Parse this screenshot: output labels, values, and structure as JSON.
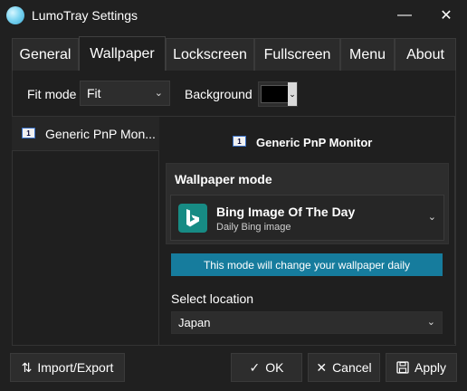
{
  "window": {
    "title": "LumoTray Settings",
    "minimize_icon": "minimize-icon",
    "close_icon": "close-icon",
    "minimize_glyph": "—",
    "close_glyph": "✕"
  },
  "tabs": [
    {
      "label": "General"
    },
    {
      "label": "Wallpaper",
      "active": true
    },
    {
      "label": "Lockscreen"
    },
    {
      "label": "Fullscreen"
    },
    {
      "label": "Menu"
    },
    {
      "label": "About"
    }
  ],
  "options": {
    "fit_mode_label": "Fit mode",
    "fit_mode_value": "Fit",
    "background_label": "Background",
    "background_color": "#000000"
  },
  "monitors": {
    "items": [
      {
        "label": "Generic PnP Mon...",
        "number": "1"
      }
    ],
    "selected_title": "Generic PnP Monitor"
  },
  "wallpaper_mode": {
    "header": "Wallpaper mode",
    "selected_title": "Bing Image Of The Day",
    "selected_subtitle": "Daily Bing image",
    "icon": "bing-icon"
  },
  "info_bar": {
    "text": "This mode will change your wallpaper daily",
    "color": "#167c9d"
  },
  "location": {
    "label": "Select location",
    "value": "Japan"
  },
  "buttons": {
    "import_export": "Import/Export",
    "ok": "OK",
    "cancel": "Cancel",
    "apply": "Apply"
  },
  "glyphs": {
    "chevron_down": "⌄",
    "import_export": "⇅",
    "ok": "✓",
    "cancel": "✕"
  }
}
